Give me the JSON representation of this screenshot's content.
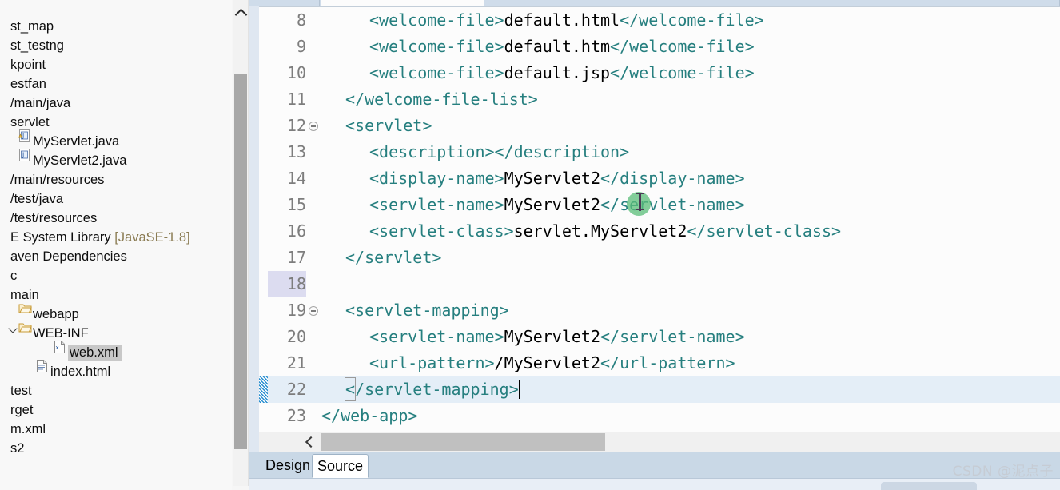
{
  "explorer": {
    "panel_name": "package-explorer",
    "rows": [
      {
        "label": "",
        "indent": 0,
        "icon": "",
        "clipped": true,
        "selected": false
      },
      {
        "label": "st_map",
        "indent": 0,
        "icon": "",
        "selected": false
      },
      {
        "label": "st_testng",
        "indent": 0,
        "icon": "",
        "selected": false
      },
      {
        "label": "kpoint",
        "indent": 0,
        "icon": "",
        "selected": false
      },
      {
        "label": "estfan",
        "indent": 0,
        "icon": "",
        "selected": false
      },
      {
        "label": "/main/java",
        "indent": 0,
        "icon": "",
        "selected": false
      },
      {
        "label": "servlet",
        "indent": 0,
        "icon": "",
        "selected": false
      },
      {
        "label": "MyServlet.java",
        "indent": 1,
        "icon": "java-warning-icon",
        "selected": false
      },
      {
        "label": "MyServlet2.java",
        "indent": 1,
        "icon": "java-icon",
        "selected": false
      },
      {
        "label": "/main/resources",
        "indent": 0,
        "icon": "",
        "selected": false
      },
      {
        "label": "/test/java",
        "indent": 0,
        "icon": "",
        "selected": false
      },
      {
        "label": "/test/resources",
        "indent": 0,
        "icon": "",
        "selected": false
      },
      {
        "label": "E System Library",
        "suffix": "[JavaSE-1.8]",
        "indent": 0,
        "icon": "",
        "selected": false
      },
      {
        "label": "aven Dependencies",
        "indent": 0,
        "icon": "",
        "selected": false
      },
      {
        "label": "c",
        "indent": 0,
        "icon": "",
        "selected": false
      },
      {
        "label": "main",
        "indent": 0,
        "icon": "",
        "selected": false
      },
      {
        "label": "webapp",
        "indent": 1,
        "icon": "folder-icon",
        "selected": false
      },
      {
        "label": "WEB-INF",
        "indent": 1,
        "icon": "folder-icon",
        "twisty": "open",
        "selected": false
      },
      {
        "label": "web.xml",
        "indent": 3,
        "icon": "xml-file-icon",
        "selected": true
      },
      {
        "label": "index.html",
        "indent": 2,
        "icon": "html-file-icon",
        "selected": false
      },
      {
        "label": "test",
        "indent": 0,
        "icon": "",
        "selected": false
      },
      {
        "label": "rget",
        "indent": 0,
        "icon": "",
        "selected": false
      },
      {
        "label": "m.xml",
        "indent": 0,
        "icon": "",
        "selected": false
      },
      {
        "label": "s2",
        "indent": 0,
        "icon": "",
        "selected": false
      }
    ],
    "scrollbar": {
      "name": "vertical-scrollbar",
      "up_arrow": "chevron-up-icon"
    }
  },
  "editor": {
    "name": "web-xml-source-editor",
    "current_line": 22,
    "marked_line": 18,
    "lines": [
      {
        "no": "8",
        "fold": false,
        "indent": 4,
        "spans": [
          {
            "c": "tag",
            "t": "<welcome-file>"
          },
          {
            "c": "txt",
            "t": "default.html"
          },
          {
            "c": "tag",
            "t": "</welcome-file>"
          }
        ]
      },
      {
        "no": "9",
        "fold": false,
        "indent": 4,
        "spans": [
          {
            "c": "tag",
            "t": "<welcome-file>"
          },
          {
            "c": "txt",
            "t": "default.htm"
          },
          {
            "c": "tag",
            "t": "</welcome-file>"
          }
        ]
      },
      {
        "no": "10",
        "fold": false,
        "indent": 4,
        "spans": [
          {
            "c": "tag",
            "t": "<welcome-file>"
          },
          {
            "c": "txt",
            "t": "default.jsp"
          },
          {
            "c": "tag",
            "t": "</welcome-file>"
          }
        ]
      },
      {
        "no": "11",
        "fold": false,
        "indent": 2,
        "spans": [
          {
            "c": "tag",
            "t": "</welcome-file-list>"
          }
        ]
      },
      {
        "no": "12",
        "fold": true,
        "indent": 2,
        "spans": [
          {
            "c": "tag",
            "t": "<servlet>"
          }
        ]
      },
      {
        "no": "13",
        "fold": false,
        "indent": 4,
        "spans": [
          {
            "c": "tag",
            "t": "<description></description>"
          }
        ]
      },
      {
        "no": "14",
        "fold": false,
        "indent": 4,
        "spans": [
          {
            "c": "tag",
            "t": "<display-name>"
          },
          {
            "c": "txt",
            "t": "MyServlet2"
          },
          {
            "c": "tag",
            "t": "</display-name>"
          }
        ]
      },
      {
        "no": "15",
        "fold": false,
        "indent": 4,
        "spans": [
          {
            "c": "tag",
            "t": "<servlet-name>"
          },
          {
            "c": "txt",
            "t": "MyServlet2"
          },
          {
            "c": "tag",
            "t": "</servlet-name>"
          }
        ]
      },
      {
        "no": "16",
        "fold": false,
        "indent": 4,
        "spans": [
          {
            "c": "tag",
            "t": "<servlet-class>"
          },
          {
            "c": "txt",
            "t": "servlet.MyServlet2"
          },
          {
            "c": "tag",
            "t": "</servlet-class>"
          }
        ]
      },
      {
        "no": "17",
        "fold": false,
        "indent": 2,
        "spans": [
          {
            "c": "tag",
            "t": "</servlet>"
          }
        ]
      },
      {
        "no": "18",
        "fold": false,
        "indent": 0,
        "spans": []
      },
      {
        "no": "19",
        "fold": true,
        "indent": 2,
        "spans": [
          {
            "c": "tag",
            "t": "<servlet-mapping>"
          }
        ]
      },
      {
        "no": "20",
        "fold": false,
        "indent": 4,
        "spans": [
          {
            "c": "tag",
            "t": "<servlet-name>"
          },
          {
            "c": "txt",
            "t": "MyServlet2"
          },
          {
            "c": "tag",
            "t": "</servlet-name>"
          }
        ]
      },
      {
        "no": "21",
        "fold": false,
        "indent": 4,
        "spans": [
          {
            "c": "tag",
            "t": "<url-pattern>"
          },
          {
            "c": "txt",
            "t": "/MyServlet2"
          },
          {
            "c": "tag",
            "t": "</url-pattern>"
          }
        ]
      },
      {
        "no": "22",
        "fold": false,
        "indent": 2,
        "current": true,
        "bracket": true,
        "caret": true,
        "spans": [
          {
            "c": "tag",
            "t": "</servlet-mapping>"
          }
        ]
      },
      {
        "no": "23",
        "fold": false,
        "indent": 0,
        "spans": [
          {
            "c": "tag",
            "t": "</web-app>"
          }
        ]
      }
    ],
    "hscrollbar": {
      "name": "horizontal-scrollbar",
      "left_arrow": "chevron-left-icon"
    }
  },
  "page_tabs": {
    "design_label": "Design",
    "source_label": "Source",
    "active": "Source"
  },
  "watermark": {
    "text": "CSDN @泥点子"
  },
  "colors": {
    "tag": "#267f7f",
    "text": "#000000",
    "current_line": "#e4eef7",
    "marker_hatch": "#2a8fd0",
    "tab_strip": "#c9d8e6",
    "cursor_blob": "#5abe78"
  }
}
